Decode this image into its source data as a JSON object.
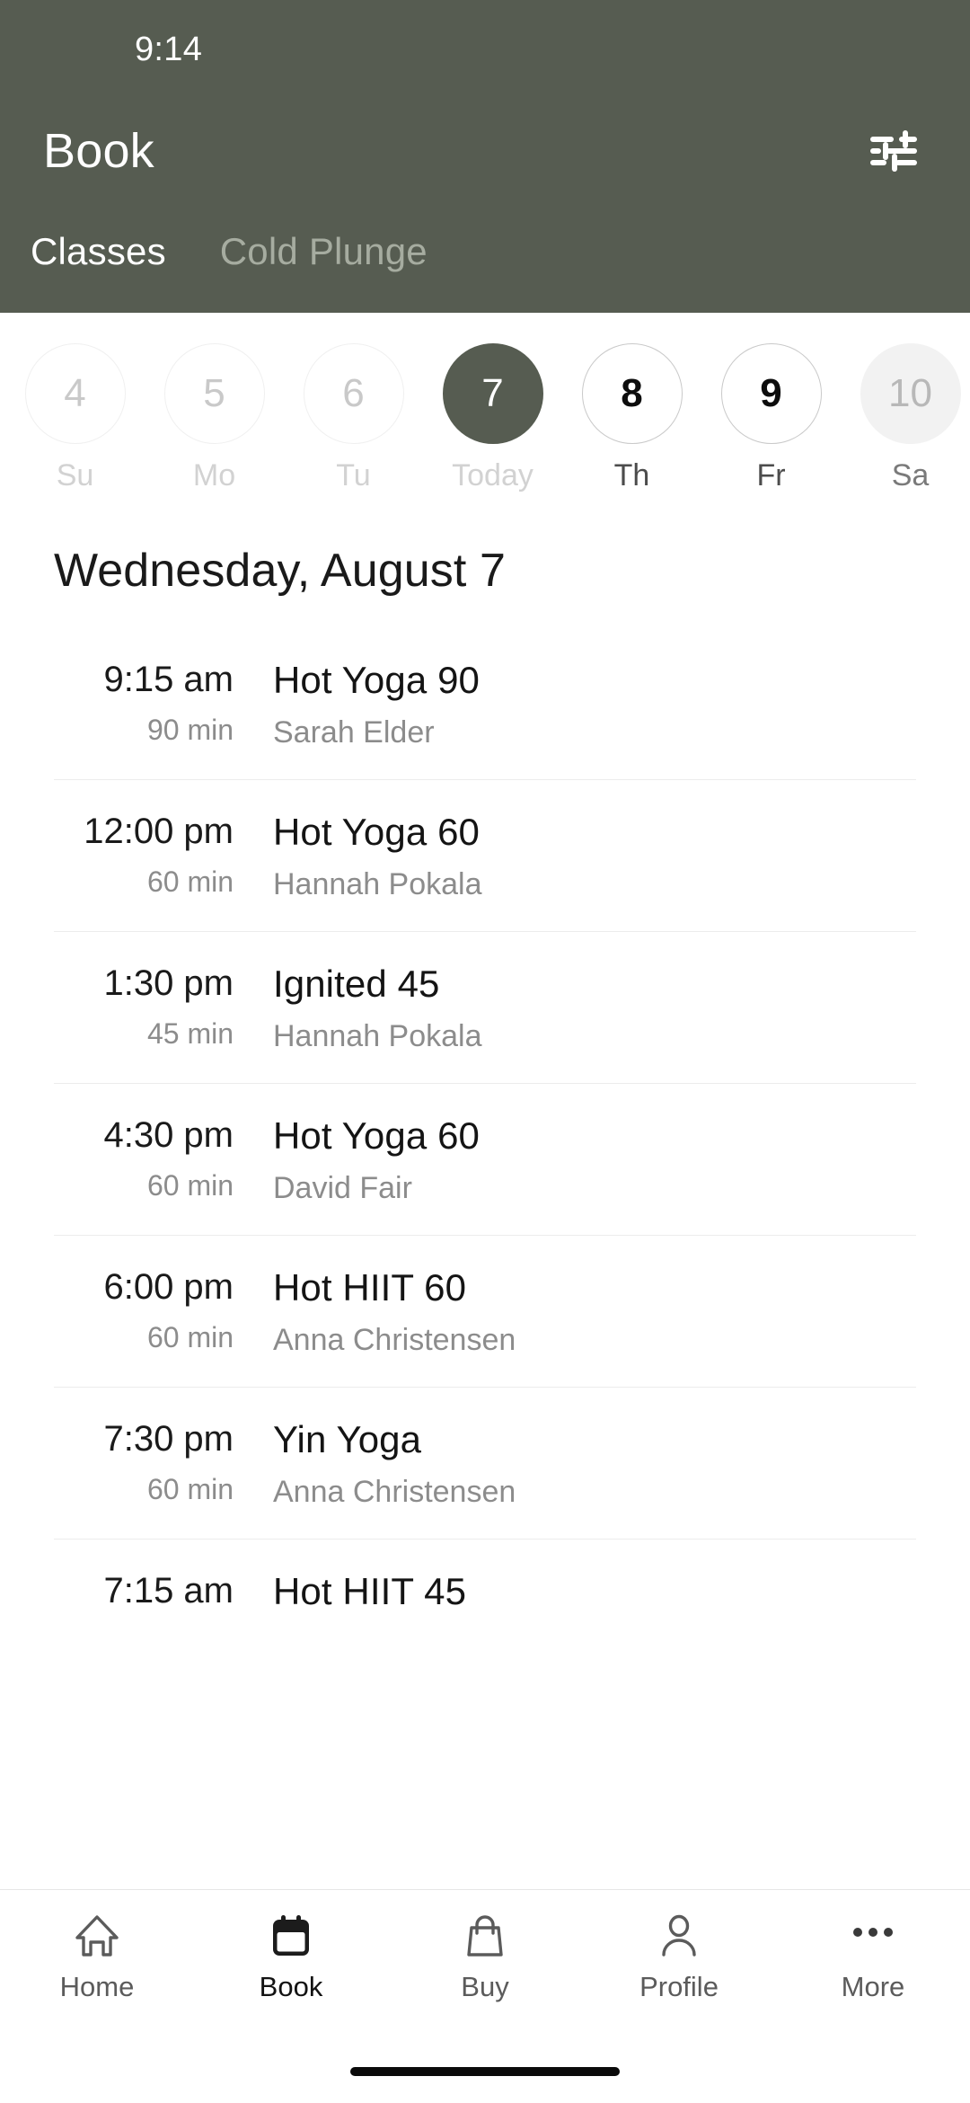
{
  "theme": {
    "header_bg": "#565c51",
    "accent": "#565c51",
    "text_primary": "#1a1a1a",
    "text_muted": "#8c8c8c"
  },
  "status_bar": {
    "time": "9:14"
  },
  "header": {
    "title": "Book",
    "filter_icon": "sliders-filter-icon",
    "tabs": [
      {
        "label": "Classes",
        "active": true
      },
      {
        "label": "Cold Plunge",
        "active": false
      }
    ]
  },
  "date_strip": {
    "days": [
      {
        "num": "4",
        "weekday": "Su",
        "state": "past"
      },
      {
        "num": "5",
        "weekday": "Mo",
        "state": "past"
      },
      {
        "num": "6",
        "weekday": "Tu",
        "state": "past"
      },
      {
        "num": "7",
        "weekday": "Today",
        "state": "selected"
      },
      {
        "num": "8",
        "weekday": "Th",
        "state": "future"
      },
      {
        "num": "9",
        "weekday": "Fr",
        "state": "future"
      },
      {
        "num": "10",
        "weekday": "Sa",
        "state": "edge"
      }
    ]
  },
  "schedule": {
    "heading": "Wednesday, August 7",
    "classes": [
      {
        "time": "9:15 am",
        "duration": "90 min",
        "name": "Hot Yoga 90",
        "instructor": "Sarah Elder"
      },
      {
        "time": "12:00 pm",
        "duration": "60 min",
        "name": "Hot Yoga 60",
        "instructor": "Hannah Pokala"
      },
      {
        "time": "1:30 pm",
        "duration": "45 min",
        "name": "Ignited 45",
        "instructor": "Hannah Pokala"
      },
      {
        "time": "4:30 pm",
        "duration": "60 min",
        "name": "Hot Yoga 60",
        "instructor": "David Fair"
      },
      {
        "time": "6:00 pm",
        "duration": "60 min",
        "name": "Hot HIIT 60",
        "instructor": "Anna Christensen"
      },
      {
        "time": "7:30 pm",
        "duration": "60 min",
        "name": "Yin Yoga",
        "instructor": "Anna Christensen"
      },
      {
        "time": "7:15 am",
        "duration": "",
        "name": "Hot HIIT 45",
        "instructor": ""
      }
    ]
  },
  "bottom_nav": {
    "items": [
      {
        "label": "Home",
        "icon": "home-icon",
        "active": false
      },
      {
        "label": "Book",
        "icon": "calendar-icon",
        "active": true
      },
      {
        "label": "Buy",
        "icon": "bag-icon",
        "active": false
      },
      {
        "label": "Profile",
        "icon": "person-icon",
        "active": false
      },
      {
        "label": "More",
        "icon": "ellipsis-icon",
        "active": false
      }
    ]
  }
}
